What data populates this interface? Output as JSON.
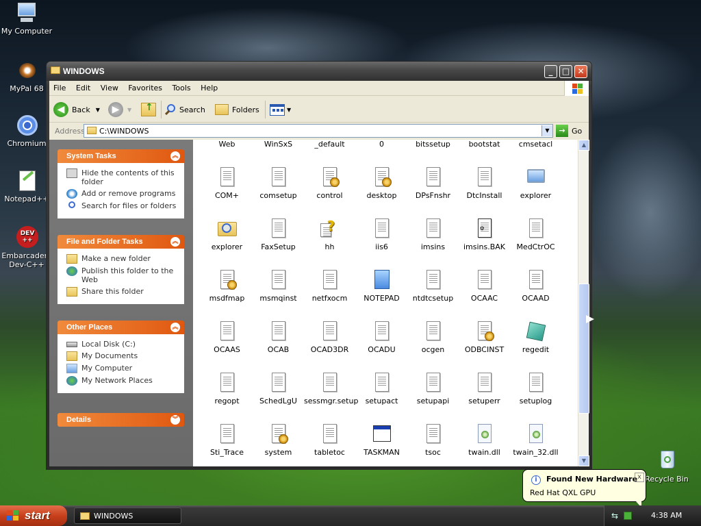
{
  "desktop": {
    "icons": [
      {
        "label": "My Computer"
      },
      {
        "label": "MyPal 68"
      },
      {
        "label": "Chromium"
      },
      {
        "label": "Notepad++"
      },
      {
        "label": "Embarcadero Dev-C++",
        "logo_text": "DEV\n++"
      },
      {
        "label": "Recycle Bin"
      }
    ]
  },
  "window": {
    "title": "WINDOWS",
    "menu": [
      "File",
      "Edit",
      "View",
      "Favorites",
      "Tools",
      "Help"
    ],
    "toolbar": {
      "back": "Back",
      "search": "Search",
      "folders": "Folders"
    },
    "address": {
      "label": "Address",
      "value": "C:\\WINDOWS",
      "go": "Go"
    },
    "task_pane": {
      "system_tasks": {
        "title": "System Tasks",
        "items": [
          "Hide the contents of this folder",
          "Add or remove programs",
          "Search for files or folders"
        ]
      },
      "file_folder_tasks": {
        "title": "File and Folder Tasks",
        "items": [
          "Make a new folder",
          "Publish this folder to the Web",
          "Share this folder"
        ]
      },
      "other_places": {
        "title": "Other Places",
        "items": [
          "Local Disk (C:)",
          "My Documents",
          "My Computer",
          "My Network Places"
        ]
      },
      "details": {
        "title": "Details"
      }
    },
    "files": [
      {
        "name": "Web",
        "icon": "folder"
      },
      {
        "name": "WinSxS",
        "icon": "folder"
      },
      {
        "name": "_default",
        "icon": "settings-doc"
      },
      {
        "name": "0",
        "icon": "doc"
      },
      {
        "name": "bitssetup",
        "icon": "doc"
      },
      {
        "name": "bootstat",
        "icon": "doc"
      },
      {
        "name": "cmsetacl",
        "icon": "doc"
      },
      {
        "name": "COM+",
        "icon": "doc"
      },
      {
        "name": "comsetup",
        "icon": "doc"
      },
      {
        "name": "control",
        "icon": "settings-doc"
      },
      {
        "name": "desktop",
        "icon": "settings-doc"
      },
      {
        "name": "DPsFnshr",
        "icon": "doc"
      },
      {
        "name": "DtcInstall",
        "icon": "doc"
      },
      {
        "name": "explorer",
        "icon": "computer"
      },
      {
        "name": "explorer",
        "icon": "search-folder"
      },
      {
        "name": "FaxSetup",
        "icon": "doc"
      },
      {
        "name": "hh",
        "icon": "help"
      },
      {
        "name": "iis6",
        "icon": "doc"
      },
      {
        "name": "imsins",
        "icon": "doc"
      },
      {
        "name": "imsins.BAK",
        "icon": "bak"
      },
      {
        "name": "MedCtrOC",
        "icon": "doc"
      },
      {
        "name": "msdfmap",
        "icon": "settings-doc"
      },
      {
        "name": "msmqinst",
        "icon": "doc"
      },
      {
        "name": "netfxocm",
        "icon": "doc"
      },
      {
        "name": "NOTEPAD",
        "icon": "notepad"
      },
      {
        "name": "ntdtcsetup",
        "icon": "doc"
      },
      {
        "name": "OCAAC",
        "icon": "doc"
      },
      {
        "name": "OCAAD",
        "icon": "doc"
      },
      {
        "name": "OCAAS",
        "icon": "doc"
      },
      {
        "name": "OCAB",
        "icon": "doc"
      },
      {
        "name": "OCAD3DR",
        "icon": "doc"
      },
      {
        "name": "OCADU",
        "icon": "doc"
      },
      {
        "name": "ocgen",
        "icon": "doc"
      },
      {
        "name": "ODBCINST",
        "icon": "settings-doc"
      },
      {
        "name": "regedit",
        "icon": "regedit"
      },
      {
        "name": "regopt",
        "icon": "doc"
      },
      {
        "name": "SchedLgU",
        "icon": "doc"
      },
      {
        "name": "sessmgr.setup",
        "icon": "doc"
      },
      {
        "name": "setupact",
        "icon": "doc"
      },
      {
        "name": "setupapi",
        "icon": "doc"
      },
      {
        "name": "setuperr",
        "icon": "doc"
      },
      {
        "name": "setuplog",
        "icon": "doc"
      },
      {
        "name": "Sti_Trace",
        "icon": "doc"
      },
      {
        "name": "system",
        "icon": "settings-doc"
      },
      {
        "name": "tabletoc",
        "icon": "doc"
      },
      {
        "name": "TASKMAN",
        "icon": "window"
      },
      {
        "name": "tsoc",
        "icon": "doc"
      },
      {
        "name": "twain.dll",
        "icon": "dll"
      },
      {
        "name": "twain_32.dll",
        "icon": "dll"
      }
    ]
  },
  "taskbar": {
    "start": "start",
    "task": "WINDOWS",
    "clock": "4:38 AM"
  },
  "balloon": {
    "title": "Found New Hardware",
    "body": "Red Hat QXL GPU",
    "close": "x"
  },
  "colors": {
    "taskpane_header": "#e05810",
    "start_button": "#c8401c",
    "balloon_bg": "#ffffe1"
  }
}
